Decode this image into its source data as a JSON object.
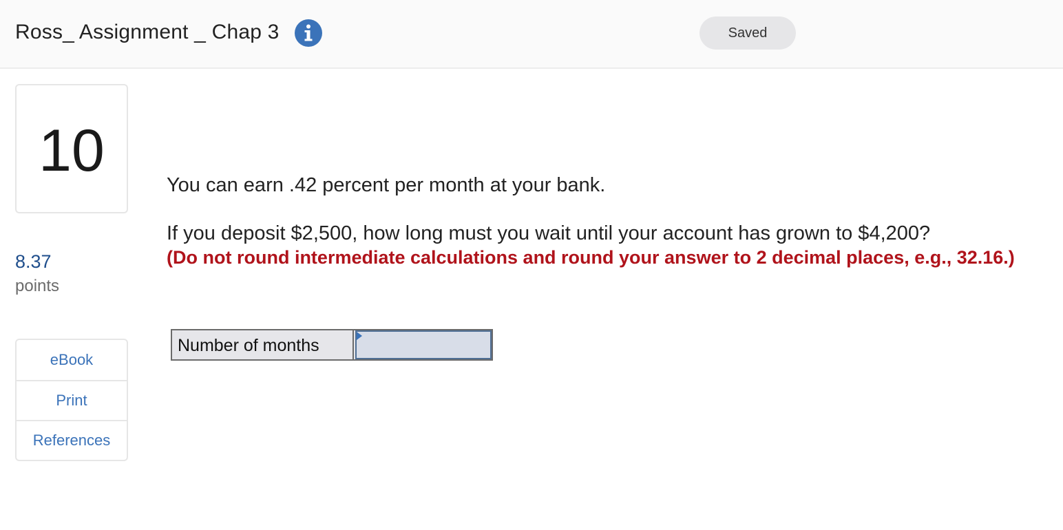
{
  "header": {
    "assignment_title": "Ross_ Assignment _ Chap 3",
    "save_status": "Saved",
    "info_icon": "info-circle-icon"
  },
  "question": {
    "number": "10",
    "points_value": "8.37",
    "points_label": "points",
    "line1": "You can earn .42 percent per month at your bank.",
    "line2": "If you deposit $2,500, how long must you wait until your account has grown to $4,200?",
    "instruction": "(Do not round intermediate calculations and round your answer to 2 decimal places, e.g., 32.16.)"
  },
  "tools": {
    "ebook": "eBook",
    "print": "Print",
    "references": "References"
  },
  "answer": {
    "label": "Number of months",
    "value": ""
  },
  "colors": {
    "info_icon": "#3b73b9",
    "instruction_text": "#b0131b",
    "link": "#3b73b9",
    "points_value": "#1f4e8c"
  }
}
